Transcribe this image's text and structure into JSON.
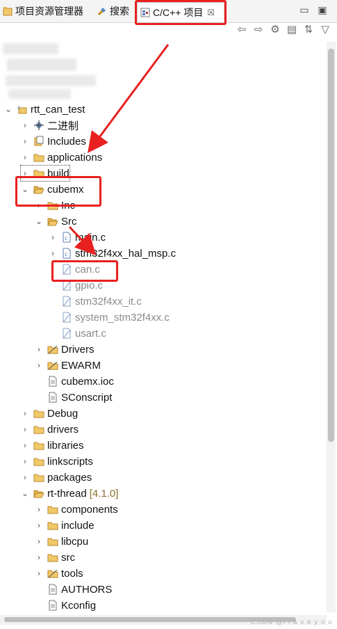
{
  "tabs": [
    {
      "label": "项目资源管理器",
      "icon": "project-explorer-icon"
    },
    {
      "label": "搜索",
      "icon": "search-icon"
    },
    {
      "label": "C/C++ 项目",
      "icon": "cpp-project-icon",
      "close": "☒"
    }
  ],
  "window_controls": {
    "minimize": "▭",
    "maximize": "▣"
  },
  "toolbar": [
    "back-arrow-icon",
    "forward-arrow-icon",
    "link-icon",
    "collapse-all-icon",
    "sync-icon",
    "view-menu-icon"
  ],
  "tree": {
    "project": "rtt_can_test",
    "binaries": "二进制",
    "includes": "Includes",
    "applications": "applications",
    "build": "build",
    "cubemx": "cubemx",
    "inc": "Inc",
    "src": "Src",
    "files_src": [
      "main.c",
      "stm32f4xx_hal_msp.c",
      "can.c",
      "gpio.c",
      "stm32f4xx_it.c",
      "system_stm32f4xx.c",
      "usart.c"
    ],
    "drivers_cap": "Drivers",
    "ewarm": "EWARM",
    "ioc": "cubemx.ioc",
    "sconscript": "SConscript",
    "debug": "Debug",
    "drivers": "drivers",
    "libraries": "libraries",
    "linkscripts": "linkscripts",
    "packages": "packages",
    "rtthread": "rt-thread",
    "rtthread_version": "[4.1.0]",
    "components": "components",
    "include": "include",
    "libcpu": "libcpu",
    "src_lower": "src",
    "tools": "tools",
    "authors": "AUTHORS",
    "kconfig": "Kconfig"
  },
  "watermark": "CSDN @l l a v e y o u",
  "colors": {
    "highlight": "#e8201f",
    "folder": "#d9a531",
    "version": "#8b6d2a"
  }
}
